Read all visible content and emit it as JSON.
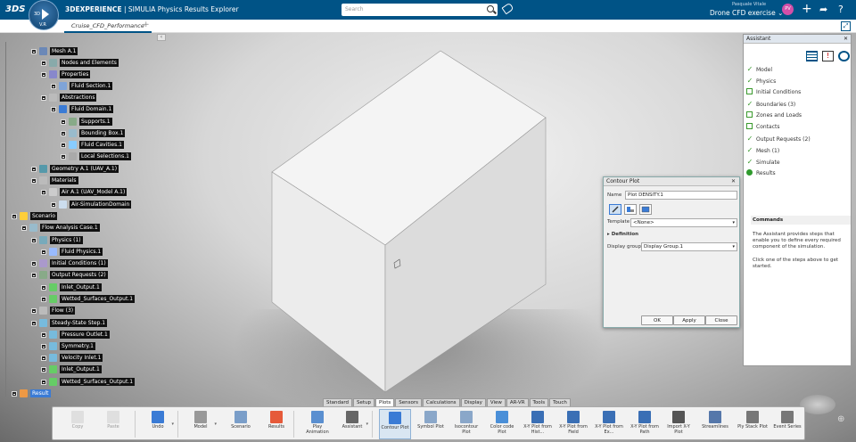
{
  "topbar": {
    "logo": "3DS",
    "compass_label": "3D",
    "compass_version": "V.R",
    "brand_bold": "3DEXPERIENCE",
    "brand_rest": " | SIMULIA",
    "app_name": "Physics Results Explorer",
    "search_placeholder": "Search",
    "user_name": "Pasquale Vitale",
    "project": "Drone CFD exercise",
    "avatar_initials": "PV"
  },
  "tabs": [
    {
      "label": "Cruise_CFD_Performance"
    }
  ],
  "tree": {
    "nodes": [
      {
        "label": "Mesh A.1",
        "depth": 2
      },
      {
        "label": "Nodes and Elements",
        "depth": 3
      },
      {
        "label": "Properties",
        "depth": 3
      },
      {
        "label": "Fluid Section.1",
        "depth": 4
      },
      {
        "label": "Abstractions",
        "depth": 3
      },
      {
        "label": "Fluid Domain.1",
        "depth": 4
      },
      {
        "label": "Supports.1",
        "depth": 5
      },
      {
        "label": "Bounding Box.1",
        "depth": 5
      },
      {
        "label": "Fluid Cavities.1",
        "depth": 5
      },
      {
        "label": "Local Selections.1",
        "depth": 5
      },
      {
        "label": "Geometry A.1 (UAV_A.1)",
        "depth": 2
      },
      {
        "label": "Materials",
        "depth": 2
      },
      {
        "label": "Air A.1 (UAV_Model A.1)",
        "depth": 3
      },
      {
        "label": "Air-SimulationDomain",
        "depth": 4
      },
      {
        "label": "Scenario",
        "depth": 0
      },
      {
        "label": "Flow Analysis Case.1",
        "depth": 1
      },
      {
        "label": "Physics (1)",
        "depth": 2
      },
      {
        "label": "Fluid Physics.1",
        "depth": 3
      },
      {
        "label": "Initial Conditions (1)",
        "depth": 2
      },
      {
        "label": "Output Requests (2)",
        "depth": 2
      },
      {
        "label": "Inlet_Output.1",
        "depth": 3
      },
      {
        "label": "Wetted_Surfaces_Output.1",
        "depth": 3
      },
      {
        "label": "Flow (3)",
        "depth": 2
      },
      {
        "label": "Steady-State Step.1",
        "depth": 2
      },
      {
        "label": "Pressure Outlet.1",
        "depth": 3
      },
      {
        "label": "Symmetry.1",
        "depth": 3
      },
      {
        "label": "Velocity Inlet.1",
        "depth": 3
      },
      {
        "label": "Inlet_Output.1",
        "depth": 3
      },
      {
        "label": "Wetted_Surfaces_Output.1",
        "depth": 3
      },
      {
        "label": "Result",
        "depth": 0
      }
    ]
  },
  "contour_dialog": {
    "title": "Contour Plot",
    "name_label": "Name",
    "name_value": "Plot DENSITY.1",
    "template_label": "Template",
    "template_value": "<None>",
    "definition_label": "Definition",
    "display_group_label": "Display group",
    "display_group_value": "Display Group.1",
    "ok": "OK",
    "apply": "Apply",
    "close": "Close"
  },
  "assistant": {
    "title": "Assistant",
    "steps": [
      {
        "label": "Model",
        "state": "done"
      },
      {
        "label": "Physics",
        "state": "done"
      },
      {
        "label": "Initial Conditions",
        "state": "todo"
      },
      {
        "label": "Boundaries (3)",
        "state": "done"
      },
      {
        "label": "Zones and Loads",
        "state": "todo"
      },
      {
        "label": "Contacts",
        "state": "todo"
      },
      {
        "label": "Output Requests (2)",
        "state": "done"
      },
      {
        "label": "Mesh (1)",
        "state": "done"
      },
      {
        "label": "Simulate",
        "state": "done"
      },
      {
        "label": "Results",
        "state": "current"
      }
    ],
    "commands_title": "Commands",
    "commands_text1": "The Assistant provides steps that enable you to define every required component of the simulation.",
    "commands_text2": "Click one of the steps above to get started."
  },
  "command_tabs": [
    "Standard",
    "Setup",
    "Plots",
    "Sensors",
    "Calculations",
    "Display",
    "View",
    "AR-VR",
    "Tools",
    "Touch"
  ],
  "command_tab_active": "Plots",
  "actions": [
    {
      "label": "Copy",
      "disabled": true
    },
    {
      "label": "Paste",
      "disabled": true
    },
    {
      "label": "Undo",
      "disabled": false
    },
    {
      "label": "Model",
      "disabled": false
    },
    {
      "label": "Scenario",
      "disabled": false
    },
    {
      "label": "Results",
      "disabled": false
    },
    {
      "label": "Play Animation",
      "disabled": false
    },
    {
      "label": "Assistant",
      "disabled": false
    },
    {
      "label": "Contour Plot",
      "disabled": false
    },
    {
      "label": "Symbol Plot",
      "disabled": false
    },
    {
      "label": "Isocontour Plot",
      "disabled": false
    },
    {
      "label": "Color code Plot",
      "disabled": false
    },
    {
      "label": "X-Y Plot from Hist...",
      "disabled": false
    },
    {
      "label": "X-Y Plot from Field",
      "disabled": false
    },
    {
      "label": "X-Y Plot from Ex...",
      "disabled": false
    },
    {
      "label": "X-Y Plot from Path",
      "disabled": false
    },
    {
      "label": "Import X-Y Plot",
      "disabled": false
    },
    {
      "label": "Streamlines",
      "disabled": false
    },
    {
      "label": "Ply Stack Plot",
      "disabled": false
    },
    {
      "label": "Event Series",
      "disabled": false
    }
  ],
  "colors": {
    "brand": "#005386",
    "check": "#3a9a2d"
  }
}
